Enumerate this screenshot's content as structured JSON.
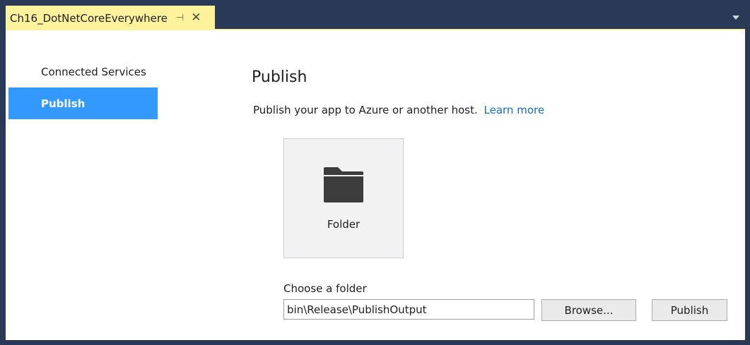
{
  "tab": {
    "title": "Ch16_DotNetCoreEverywhere",
    "pin_icon": "pin-icon",
    "pin_glyph": "⊣",
    "close_icon": "close-icon",
    "close_glyph": "✕",
    "dropdown_icon": "chevron-down-icon"
  },
  "colors": {
    "frame": "#293955",
    "tab_active": "#fff29d",
    "sidebar_active": "#3399ff",
    "link": "#0e70c0"
  },
  "sidebar": {
    "items": [
      {
        "label": "Connected Services",
        "active": false
      },
      {
        "label": "Publish",
        "active": true
      }
    ]
  },
  "main": {
    "title": "Publish",
    "subtitle": "Publish your app to Azure or another host.",
    "learn_more": "Learn more",
    "target": {
      "icon": "folder-icon",
      "label": "Folder"
    },
    "folder_label": "Choose a folder",
    "folder_value": "bin\\Release\\PublishOutput",
    "browse_label": "Browse...",
    "publish_label": "Publish"
  }
}
